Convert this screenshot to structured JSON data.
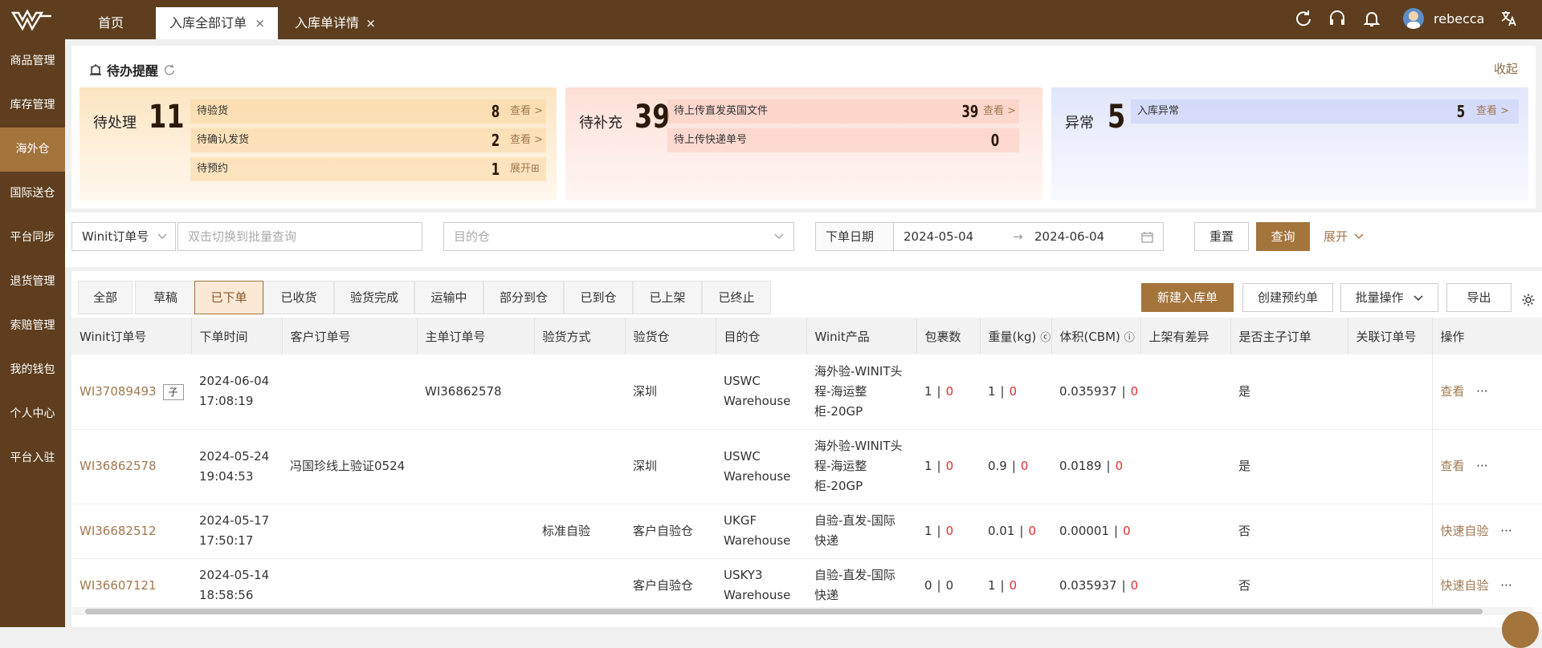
{
  "topbar": {
    "tabs": [
      {
        "label": "首页"
      },
      {
        "label": "入库全部订单"
      },
      {
        "label": "入库单详情"
      }
    ],
    "close_glyph": "×",
    "user_name": "rebecca",
    "icons": [
      "refresh-icon",
      "headset-icon",
      "bell-icon",
      "translate-icon"
    ],
    "colors": {
      "bar": "#5e3e1e",
      "accent": "#a4743d",
      "link": "#a07850"
    }
  },
  "sidebar": {
    "items": [
      {
        "label": "商品管理"
      },
      {
        "label": "库存管理"
      },
      {
        "label": "海外仓"
      },
      {
        "label": "国际送仓"
      },
      {
        "label": "平台同步"
      },
      {
        "label": "退货管理"
      },
      {
        "label": "索赔管理"
      },
      {
        "label": "我的钱包"
      },
      {
        "label": "个人中心"
      },
      {
        "label": "平台入驻"
      }
    ],
    "active_index": 2
  },
  "todo": {
    "title": "待办提醒",
    "collapse_label": "收起",
    "cards": [
      {
        "label": "待处理",
        "count": "11",
        "rows": [
          {
            "label": "待验货",
            "value": "8",
            "link": "查看 >"
          },
          {
            "label": "待确认发货",
            "value": "2",
            "link": "查看 >"
          },
          {
            "label": "待预约",
            "value": "1",
            "link": "展开⊞"
          }
        ]
      },
      {
        "label": "待补充",
        "count": "39",
        "rows": [
          {
            "label": "待上传直发英国文件",
            "value": "39",
            "link": "查看 >"
          },
          {
            "label": "待上传快递单号",
            "value": "0",
            "link": ""
          }
        ]
      },
      {
        "label": "异常",
        "count": "5",
        "rows": [
          {
            "label": "入库异常",
            "value": "5",
            "link": "查看 >"
          }
        ]
      }
    ]
  },
  "filters": {
    "order_type": "Winit订单号",
    "search_placeholder": "双击切换到批量查询",
    "warehouse_placeholder": "目的仓",
    "date_label": "下单日期",
    "date_start": "2024-05-04",
    "date_arrow": "→",
    "date_end": "2024-06-04",
    "reset_label": "重置",
    "query_label": "查询",
    "expand_label": "展开"
  },
  "status_tabs": [
    "全部",
    "草稿",
    "已下单",
    "已收货",
    "验货完成",
    "运输中",
    "部分到仓",
    "已到仓",
    "已上架",
    "已终止"
  ],
  "active_status_index": 2,
  "actions": {
    "new_label": "新建入库单",
    "booking_label": "创建预约单",
    "batch_label": "批量操作",
    "export_label": "导出"
  },
  "table": {
    "headers": [
      "Winit订单号",
      "下单时间",
      "客户订单号",
      "主单订单号",
      "验货方式",
      "验货仓",
      "目的仓",
      "Winit产品",
      "包裹数",
      "重量(kg)",
      "体积(CBM)",
      "上架有差异",
      "是否主子订单",
      "关联订单号",
      "操作"
    ],
    "rows": [
      {
        "order": "WI37089493",
        "tag": "子",
        "date": "2024-06-04",
        "time": "17:08:19",
        "customer": "",
        "master": "WI36862578",
        "method": "",
        "inspect": "深圳",
        "dest1": "USWC",
        "dest2": "Warehouse",
        "product": [
          "海外验-WINIT头",
          "程-海运整",
          "柜-20GP"
        ],
        "pkg": "1",
        "pkg_diff": "0",
        "weight": "1",
        "weight_diff": "0",
        "volume": "0.035937",
        "volume_diff": "0",
        "diff": "",
        "is_master": "是",
        "related": "",
        "op": "查看"
      },
      {
        "order": "WI36862578",
        "tag": "",
        "date": "2024-05-24",
        "time": "19:04:53",
        "customer": "冯国珍线上验证0524",
        "master": "",
        "method": "",
        "inspect": "深圳",
        "dest1": "USWC",
        "dest2": "Warehouse",
        "product": [
          "海外验-WINIT头",
          "程-海运整",
          "柜-20GP"
        ],
        "pkg": "1",
        "pkg_diff": "0",
        "weight": "0.9",
        "weight_diff": "0",
        "volume": "0.0189",
        "volume_diff": "0",
        "diff": "",
        "is_master": "是",
        "related": "",
        "op": "查看"
      },
      {
        "order": "WI36682512",
        "tag": "",
        "date": "2024-05-17",
        "time": "17:50:17",
        "customer": "",
        "master": "",
        "method": "标准自验",
        "inspect": "客户自验仓",
        "dest1": "UKGF",
        "dest2": "Warehouse",
        "product": [
          "自验-直发-国际",
          "快递"
        ],
        "pkg": "1",
        "pkg_diff": "0",
        "weight": "0.01",
        "weight_diff": "0",
        "volume": "0.00001",
        "volume_diff": "0",
        "diff": "",
        "is_master": "否",
        "related": "",
        "op": "快速自验"
      },
      {
        "order": "WI36607121",
        "tag": "",
        "date": "2024-05-14",
        "time": "18:58:56",
        "customer": "",
        "master": "",
        "method": "",
        "inspect": "客户自验仓",
        "dest1": "USKY3",
        "dest2": "Warehouse",
        "product": [
          "自验-直发-国际",
          "快递"
        ],
        "pkg": "0",
        "pkg_diff": "0",
        "weight": "1",
        "weight_diff": "0",
        "volume": "0.035937",
        "volume_diff": "0",
        "diff": "",
        "is_master": "否",
        "related": "",
        "op": "快速自验"
      }
    ],
    "more_glyph": "···"
  }
}
